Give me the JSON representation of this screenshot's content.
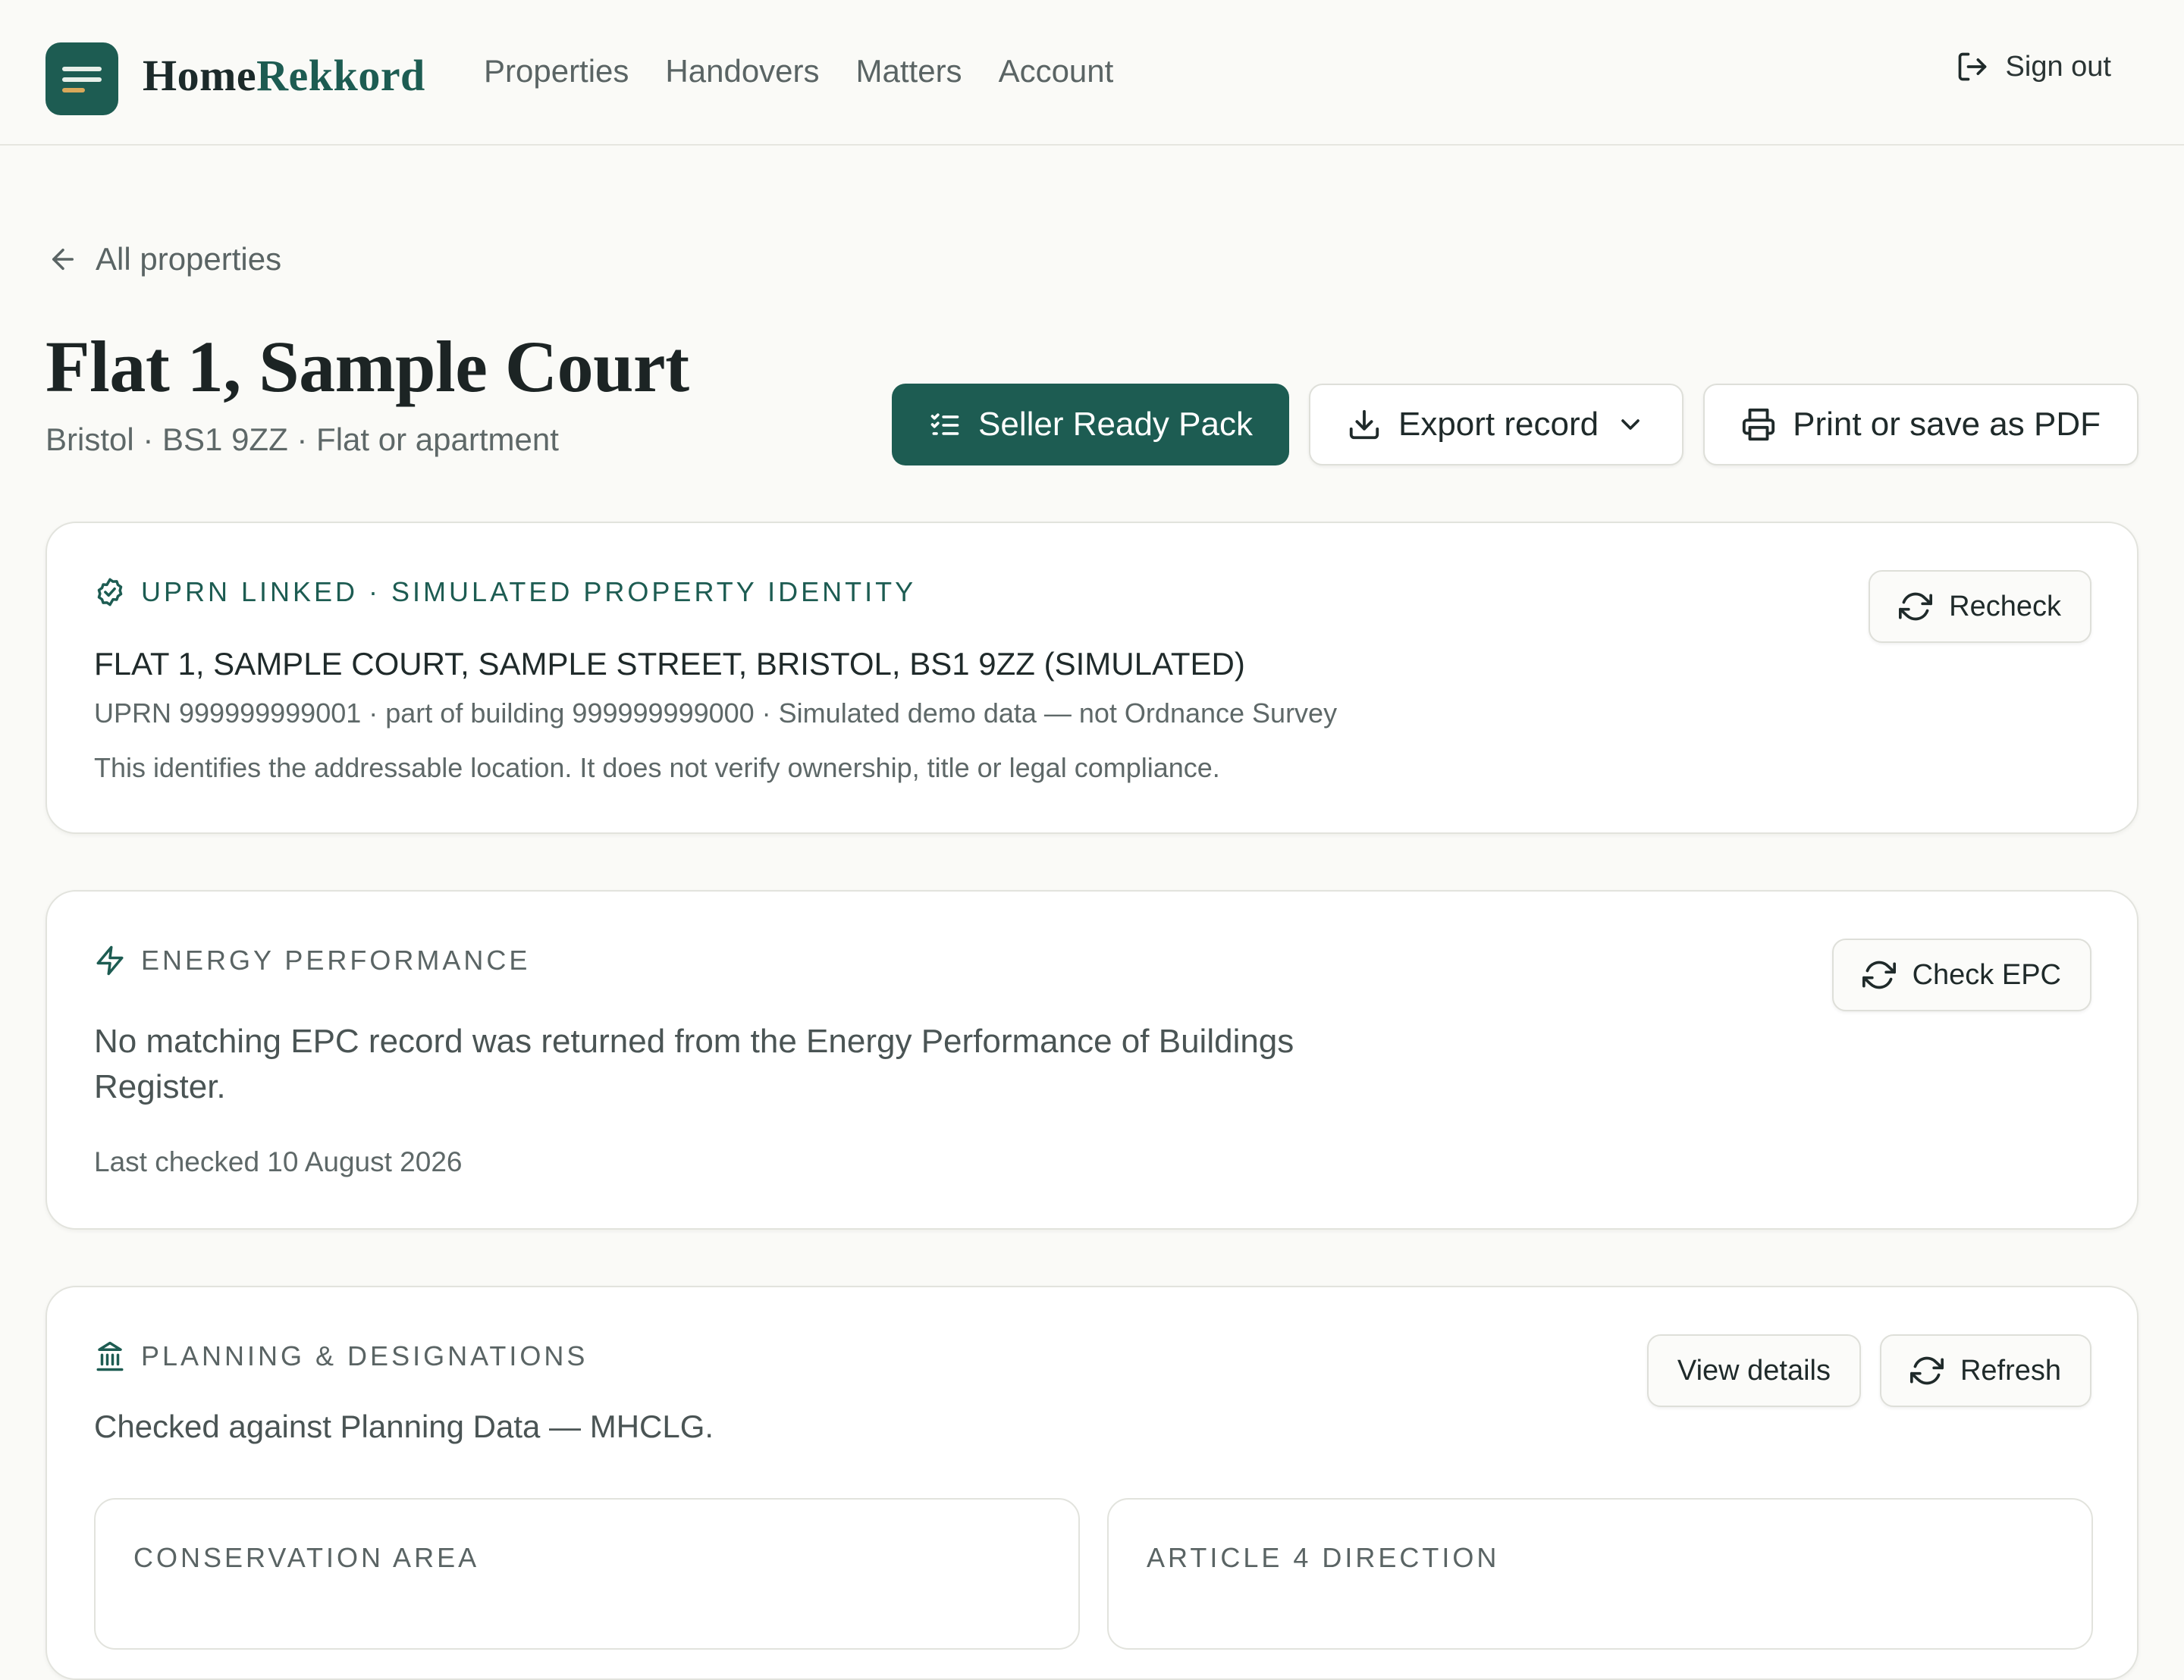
{
  "brand": {
    "part1": "Home",
    "part2": "Rekkord"
  },
  "nav": {
    "items": [
      "Properties",
      "Handovers",
      "Matters",
      "Account"
    ]
  },
  "header": {
    "signout_label": "Sign out"
  },
  "page": {
    "back_label": "All properties",
    "title": "Flat 1, Sample Court",
    "subtitle": "Bristol · BS1 9ZZ · Flat or apartment"
  },
  "actions": {
    "seller_ready_label": "Seller Ready Pack",
    "export_label": "Export record",
    "print_label": "Print or save as PDF"
  },
  "uprn_card": {
    "label": "UPRN LINKED · SIMULATED PROPERTY IDENTITY",
    "address": "FLAT 1, SAMPLE COURT, SAMPLE STREET, BRISTOL, BS1 9ZZ (SIMULATED)",
    "meta": "UPRN 999999999001 · part of building 999999999000 · Simulated demo data — not Ordnance Survey",
    "note": "This identifies the addressable location. It does not verify ownership, title or legal compliance.",
    "recheck_label": "Recheck"
  },
  "energy_card": {
    "label": "ENERGY PERFORMANCE",
    "message": "No matching EPC record was returned from the Energy Performance of Buildings Register.",
    "last_checked": "Last checked 10 August 2026",
    "check_label": "Check EPC"
  },
  "planning_card": {
    "label": "PLANNING & DESIGNATIONS",
    "source": "Checked against Planning Data — MHCLG.",
    "view_details_label": "View details",
    "refresh_label": "Refresh",
    "sub_cards": [
      "CONSERVATION AREA",
      "ARTICLE 4 DIRECTION"
    ]
  },
  "colors": {
    "accent": "#1d5c52",
    "logo_accent": "#d9a85a",
    "background": "#fafaf7",
    "muted_text": "#5e6868"
  },
  "icons": {
    "logo": "menu-lines-icon",
    "signout": "sign-out-icon",
    "back": "arrow-left-icon",
    "seller_ready": "checklist-icon",
    "export": "download-icon",
    "export_menu": "chevron-down-icon",
    "print": "printer-icon",
    "uprn": "badge-check-icon",
    "refresh": "refresh-icon",
    "energy": "lightning-icon",
    "planning": "landmark-icon"
  }
}
